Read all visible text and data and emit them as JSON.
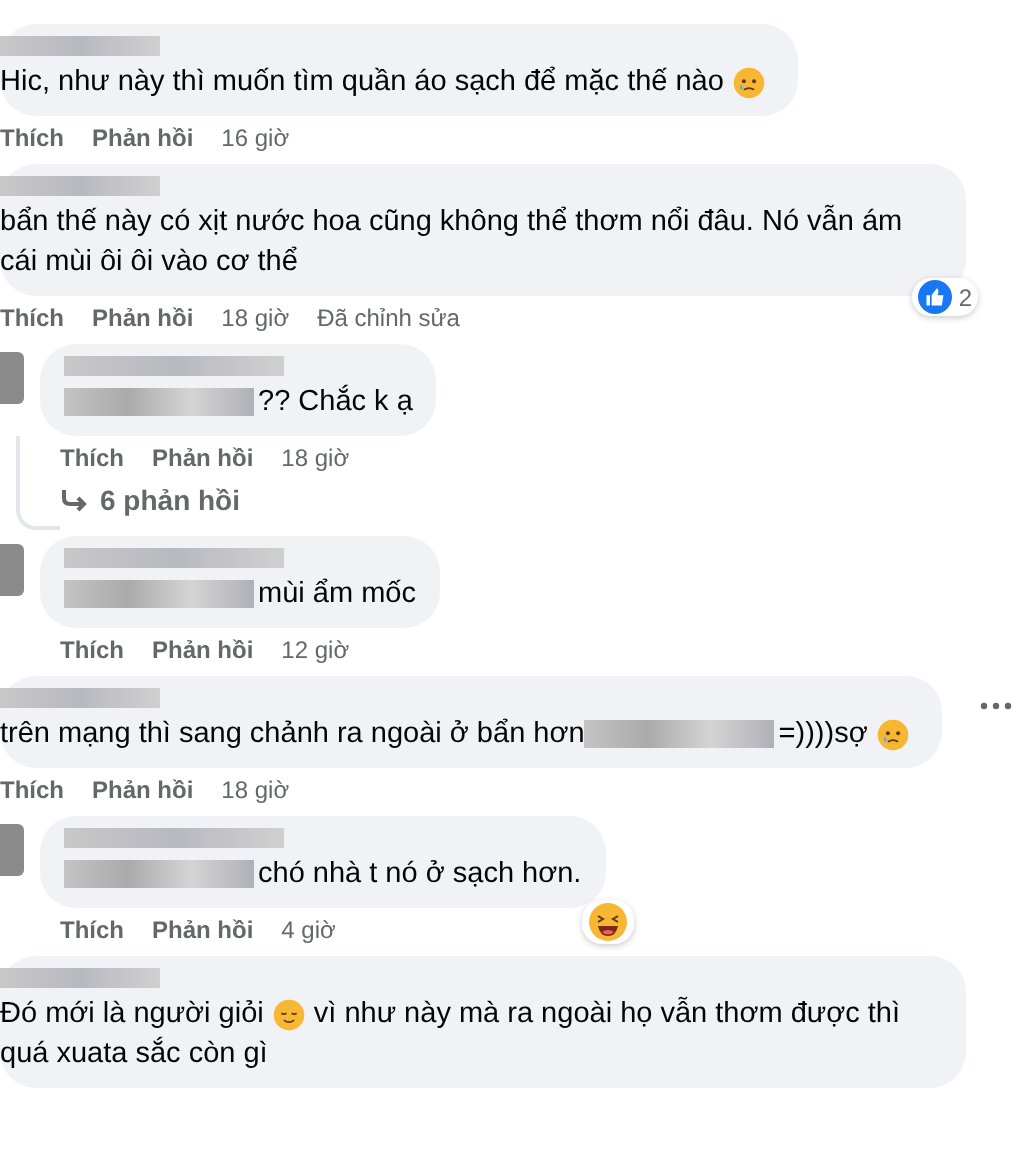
{
  "comments": [
    {
      "kind": "comment",
      "body": [
        {
          "kind": "text",
          "text": "Hic, như này thì muốn tìm quần áo sạch để mặc thế nào"
        },
        {
          "kind": "tear"
        }
      ],
      "actions": [
        "Thích",
        "Phản hồi"
      ],
      "time": "16 giờ"
    },
    {
      "kind": "comment",
      "body": [
        {
          "kind": "text",
          "text": "bẩn thế này có xịt nước hoa cũng không thể thơm nổi đâu. Nó vẫn ám cái mùi ôi ôi vào cơ thể"
        }
      ],
      "reaction": {
        "kind": "like",
        "count": "2"
      },
      "actions": [
        "Thích",
        "Phản hồi"
      ],
      "time": "18 giờ",
      "edited": "Đã chỉnh sửa"
    },
    {
      "kind": "reply",
      "body": [
        {
          "kind": "blur"
        },
        {
          "kind": "text",
          "text": "?? Chắc k ạ"
        }
      ],
      "actions": [
        "Thích",
        "Phản hồi"
      ],
      "time": "18 giờ",
      "replies": "6 phản hồi"
    },
    {
      "kind": "reply",
      "body": [
        {
          "kind": "blur"
        },
        {
          "kind": "text",
          "text": "mùi ẩm mốc"
        }
      ],
      "actions": [
        "Thích",
        "Phản hồi"
      ],
      "time": "12 giờ"
    },
    {
      "kind": "comment",
      "body": [
        {
          "kind": "text",
          "text": "trên mạng thì sang chảnh ra ngoài ở bẩn hơn"
        },
        {
          "kind": "blur"
        },
        {
          "kind": "text",
          "text": "=))))sợ"
        },
        {
          "kind": "tear"
        }
      ],
      "menu": true,
      "actions": [
        "Thích",
        "Phản hồi"
      ],
      "time": "18 giờ"
    },
    {
      "kind": "reply",
      "body": [
        {
          "kind": "blur"
        },
        {
          "kind": "text",
          "text": "chó nhà t nó ở sạch hơn."
        }
      ],
      "reaction": {
        "kind": "haha"
      },
      "actions": [
        "Thích",
        "Phản hồi"
      ],
      "time": "4 giờ"
    },
    {
      "kind": "comment",
      "body": [
        {
          "kind": "text",
          "text": "Đó mới là người giỏi"
        },
        {
          "kind": "smile"
        },
        {
          "kind": "text",
          "text": "vì như này mà ra ngoài họ vẫn thơm được thì"
        },
        {
          "kind": "text",
          "text": "quá xuata sắc còn gì"
        }
      ]
    }
  ]
}
